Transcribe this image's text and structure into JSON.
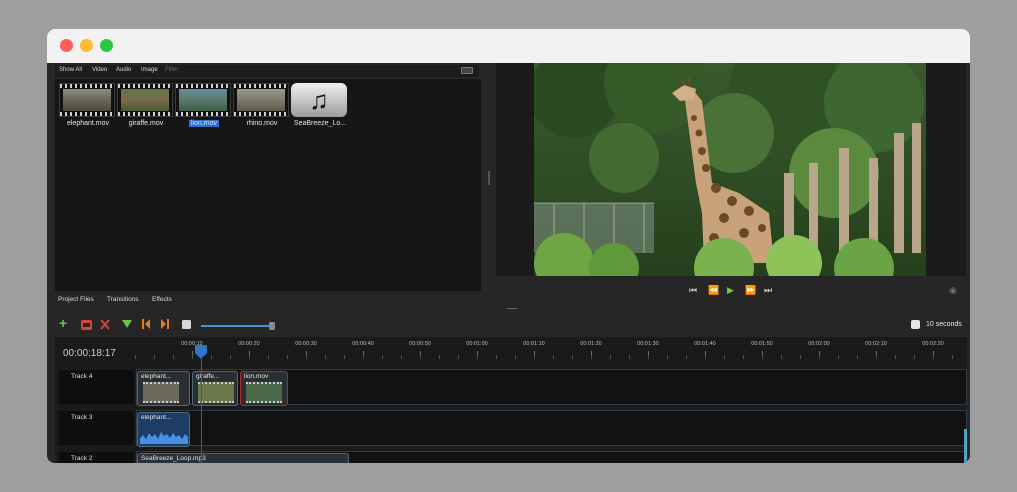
{
  "filter_bar": {
    "tabs": [
      "Show All",
      "Video",
      "Audio",
      "Image"
    ],
    "filter_placeholder": "Filter"
  },
  "files": [
    {
      "name": "elephant.mov",
      "icon": "elephant-thumbnail",
      "selected": false
    },
    {
      "name": "giraffe.mov",
      "icon": "giraffe-thumbnail",
      "selected": false
    },
    {
      "name": "lion.mov",
      "icon": "lion-thumbnail",
      "selected": true
    },
    {
      "name": "rhino.mov",
      "icon": "rhino-thumbnail",
      "selected": false
    },
    {
      "name": "SeaBreeze_Lo...",
      "icon": "music-note-icon",
      "selected": false
    }
  ],
  "music_glyph": "♫",
  "bottom_tabs": [
    "Project Files",
    "Transitions",
    "Effects"
  ],
  "player_controls": {
    "jump_start": "⏮",
    "rewind": "⏪",
    "play": "▶",
    "fast_forward": "⏩",
    "jump_end": "⏭",
    "camera": "◉"
  },
  "toolbar": {
    "add": "+",
    "zoom_label": "10 seconds"
  },
  "timeline": {
    "timecode": "00:00:18:17",
    "ruler_ticks": [
      "00:00:10",
      "00:00:20",
      "00:00:30",
      "00:00:40",
      "00:00:50",
      "00:01:00",
      "00:01:10",
      "00:01:20",
      "00:01:30",
      "00:01:40",
      "00:01:50",
      "00:02:00",
      "00:02:10",
      "00:02:20"
    ],
    "tracks": [
      {
        "name": "Track 4",
        "clips": [
          {
            "title": "elephant...",
            "type": "video"
          },
          {
            "title": "giraffe...",
            "type": "video"
          },
          {
            "title": "lion.mov",
            "type": "video"
          }
        ]
      },
      {
        "name": "Track 3",
        "clips": [
          {
            "title": "elephant...",
            "type": "audio"
          }
        ]
      },
      {
        "name": "Track 2",
        "clips": [
          {
            "title": "SeaBreeze_Loop.mp3",
            "type": "audio"
          }
        ]
      }
    ]
  },
  "colors": {
    "accent_blue": "#2a6fd6",
    "play_green": "#79c933",
    "playhead_red": "#d22222",
    "add_green": "#6cc24a",
    "razor_red": "#d6443a",
    "snap_orange": "#e07b25"
  }
}
